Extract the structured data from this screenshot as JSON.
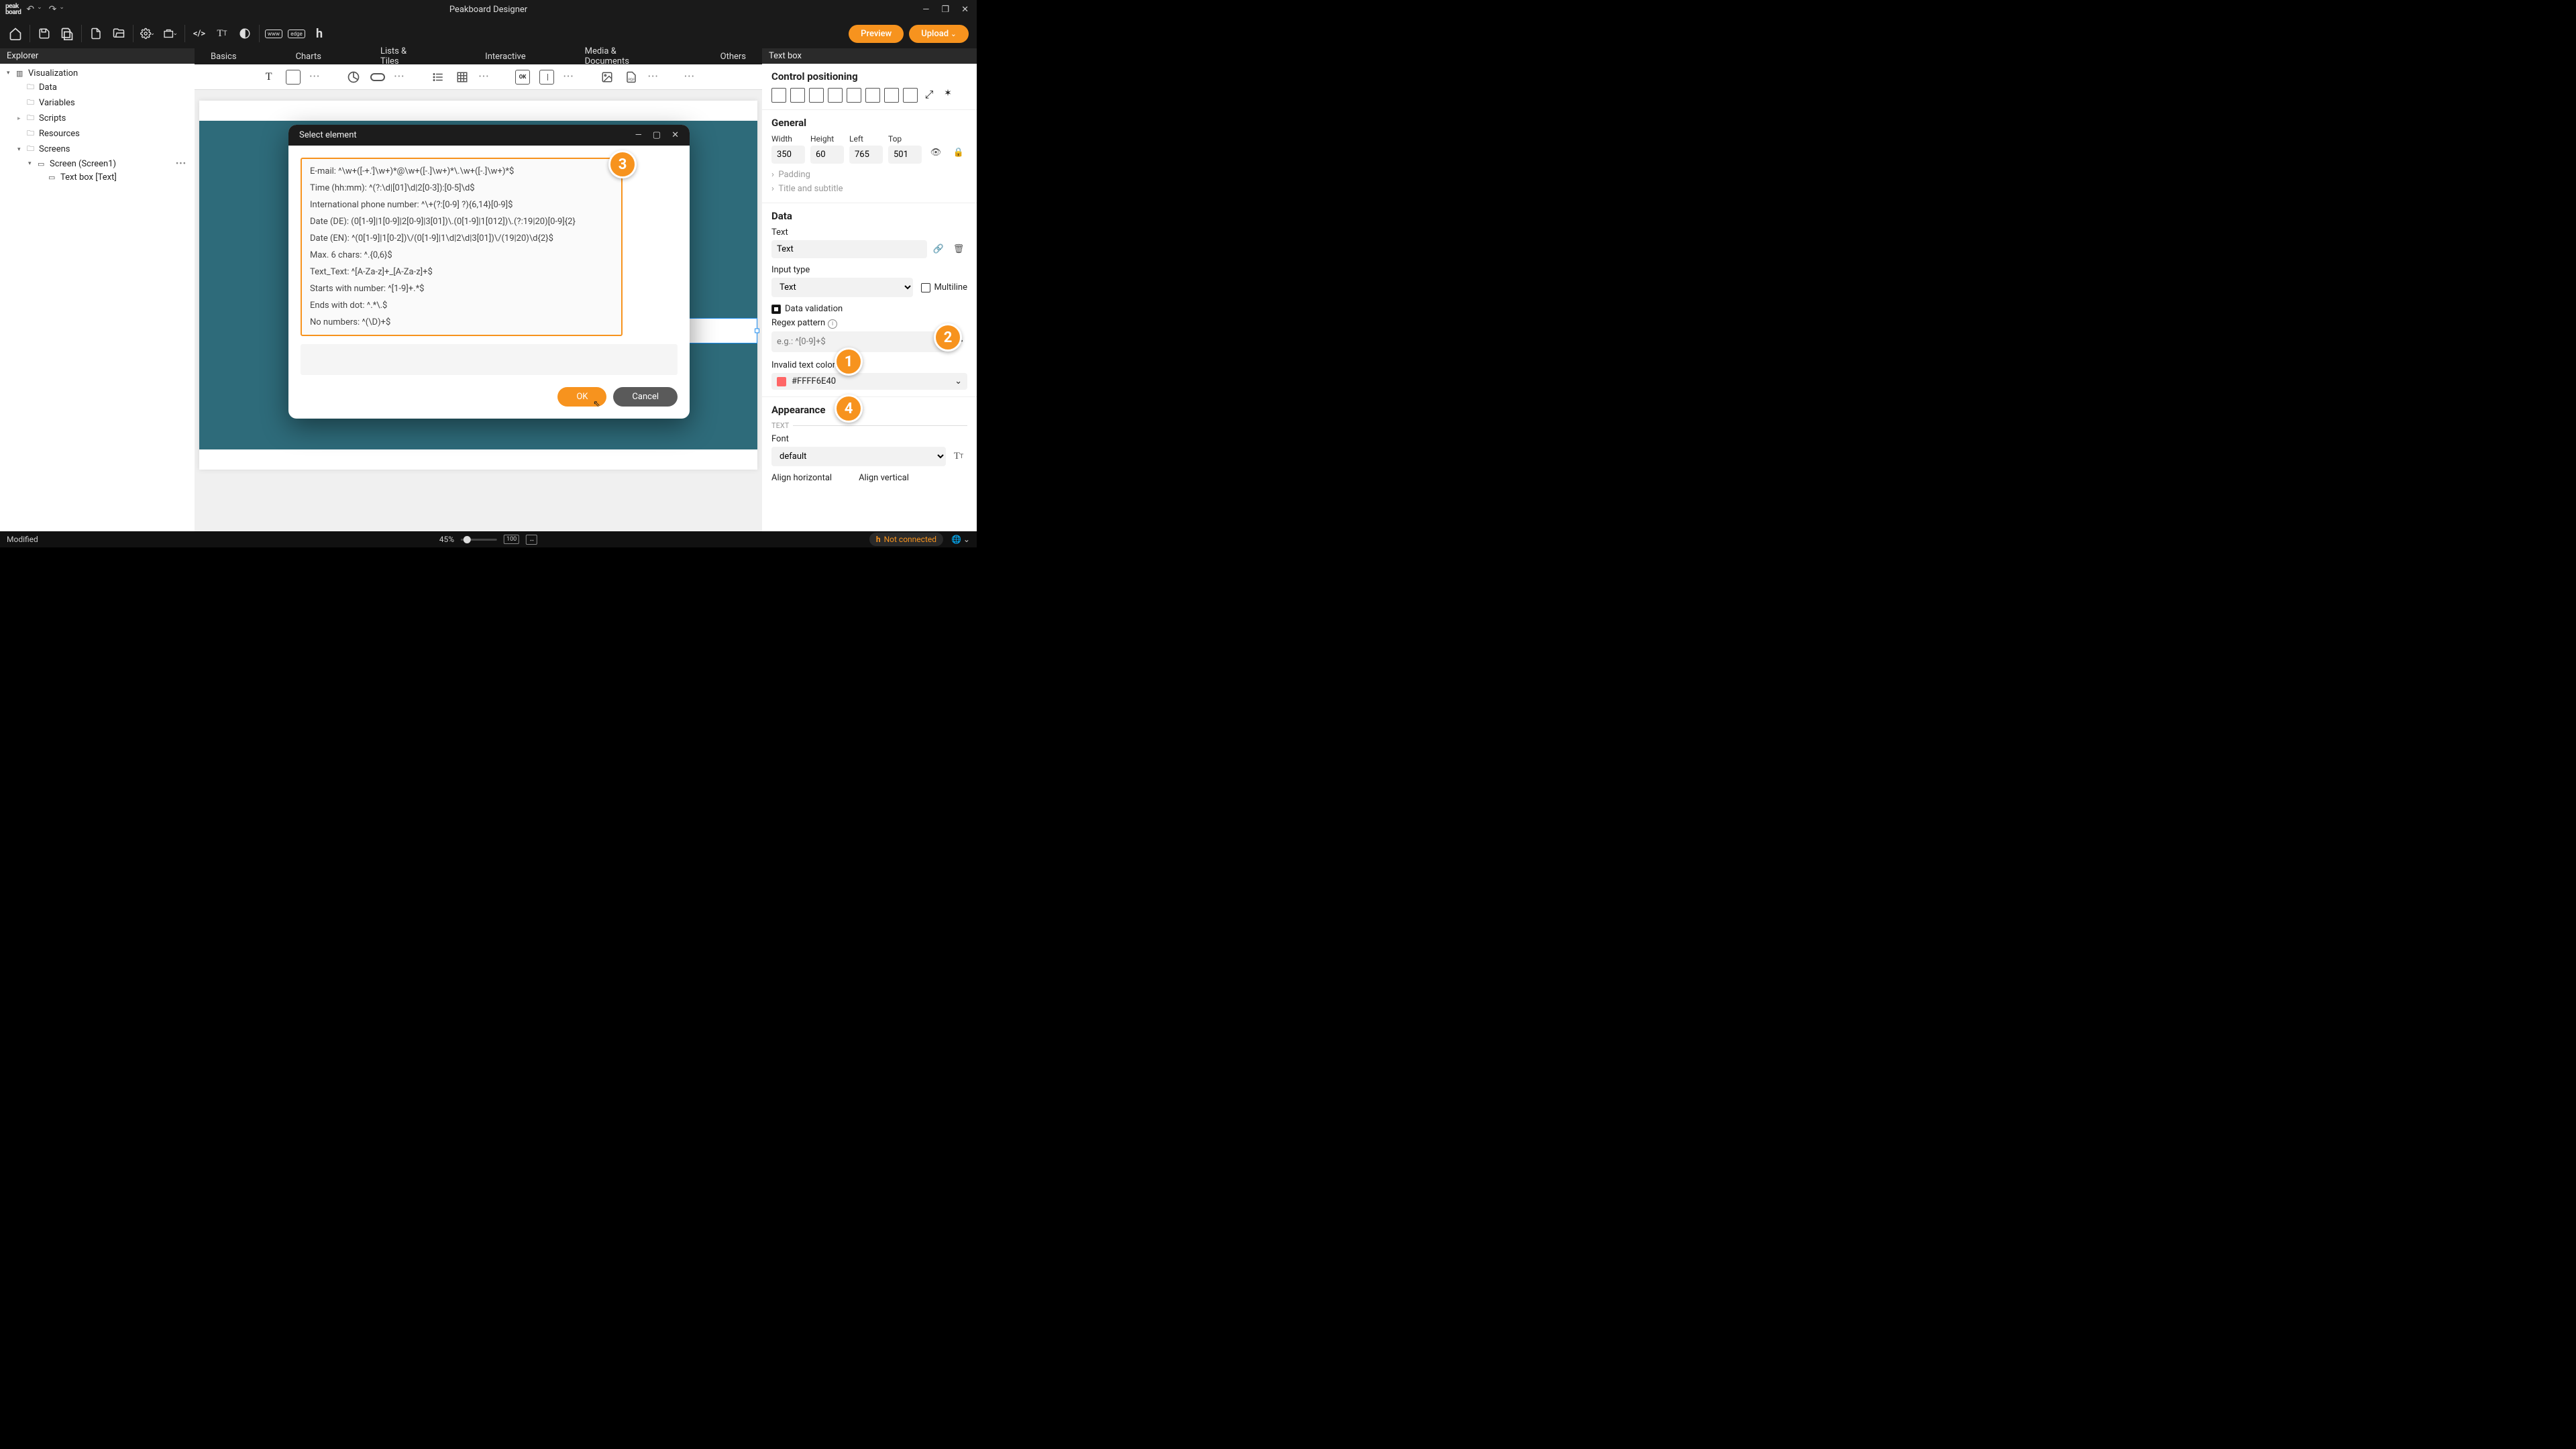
{
  "app_title": "Peakboard Designer",
  "logo": {
    "l1": "peak",
    "l2": "board"
  },
  "toolbar": {
    "preview": "Preview",
    "upload": "Upload"
  },
  "explorer": {
    "title": "Explorer",
    "root": "Visualization",
    "nodes": [
      "Data",
      "Variables",
      "Scripts",
      "Resources",
      "Screens"
    ],
    "screen": "Screen (Screen1)",
    "textbox": "Text box [Text]"
  },
  "ribbon_tabs": [
    "Basics",
    "Charts",
    "Lists & Tiles",
    "Interactive",
    "Media & Documents",
    "Others"
  ],
  "modal": {
    "title": "Select element",
    "items": [
      "E-mail: ^\\w+([-+.']\\w+)*@\\w+([-.]\\w+)*\\.\\w+([-.]\\w+)*$",
      "Time (hh:mm): ^(?:\\d|[01]\\d|2[0-3]):[0-5]\\d$",
      "International phone number: ^\\+(?:[0-9] ?){6,14}[0-9]$",
      "Date (DE): (0[1-9]|1[0-9]|2[0-9]|3[01])\\.(0[1-9]|1[012])\\.(?:19|20)[0-9]{2}",
      "Date (EN): ^(0[1-9]|1[0-2])\\/(0[1-9]|1\\d|2\\d|3[01])\\/(19|20)\\d{2}$",
      "Max. 6 chars: ^.{0,6}$",
      "Text_Text: ^[A-Za-z]+_[A-Za-z]+$",
      "Starts with number: ^[1-9]+.*$",
      "Ends with dot: ^.*\\.$",
      "No numbers: ^(\\D)+$"
    ],
    "ok": "OK",
    "cancel": "Cancel"
  },
  "props": {
    "title": "Text box",
    "positioning": "Control positioning",
    "general": {
      "title": "General",
      "width_l": "Width",
      "width": "350",
      "height_l": "Height",
      "height": "60",
      "left_l": "Left",
      "left": "765",
      "top_l": "Top",
      "top": "501",
      "padding": "Padding",
      "titlesub": "Title and subtitle"
    },
    "data": {
      "title": "Data",
      "text_l": "Text",
      "text": "Text",
      "inputtype_l": "Input type",
      "inputtype": "Text",
      "multiline": "Multiline",
      "datavalidation": "Data validation",
      "regex_l": "Regex pattern",
      "regex_ph": "e.g.: ^[0-9]+$",
      "invalidcolor_l": "Invalid text color",
      "invalidcolor": "#FFFF6E40"
    },
    "appearance": {
      "title": "Appearance",
      "text_div": "TEXT",
      "font_l": "Font",
      "font": "default",
      "alignh": "Align horizontal",
      "alignv": "Align vertical"
    }
  },
  "status": {
    "modified": "Modified",
    "zoom": "45%",
    "zoom_100": "100",
    "not_connected": "Not connected"
  },
  "callouts": {
    "c1": "1",
    "c2": "2",
    "c3": "3",
    "c4": "4"
  }
}
